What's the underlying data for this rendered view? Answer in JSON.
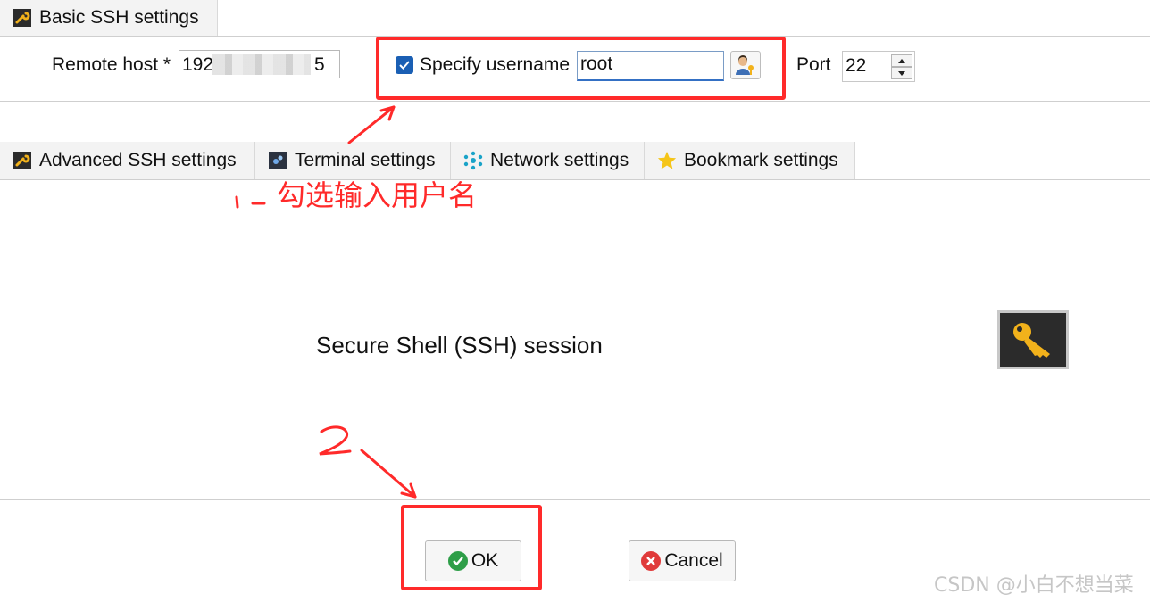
{
  "tabs_top": [
    {
      "label": "Basic SSH settings",
      "icon": "wrench-icon"
    }
  ],
  "basic": {
    "remote_host_label": "Remote host *",
    "remote_host_prefix": "192",
    "remote_host_suffix": "5",
    "specify_username_label": "Specify username",
    "specify_username_checked": true,
    "username_value": "root",
    "port_label": "Port",
    "port_value": "22"
  },
  "tabs_secondary": [
    {
      "label": "Advanced SSH settings",
      "icon": "wrench-icon"
    },
    {
      "label": "Terminal settings",
      "icon": "terminal-icon"
    },
    {
      "label": "Network settings",
      "icon": "network-icon"
    },
    {
      "label": "Bookmark settings",
      "icon": "star-icon"
    }
  ],
  "main": {
    "session_label": "Secure Shell (SSH) session",
    "session_icon": "key-icon"
  },
  "buttons": {
    "ok_label": "OK",
    "cancel_label": "Cancel"
  },
  "annotations": {
    "step1_text": "勾选输入用户名",
    "highlight_color": "#ff2a2a"
  },
  "watermark": "CSDN @小白不想当菜",
  "colors": {
    "checkbox": "#1a5fb4",
    "ok_icon": "#2e9e48",
    "cancel_icon": "#e03a3a",
    "key": "#f2b21b"
  }
}
